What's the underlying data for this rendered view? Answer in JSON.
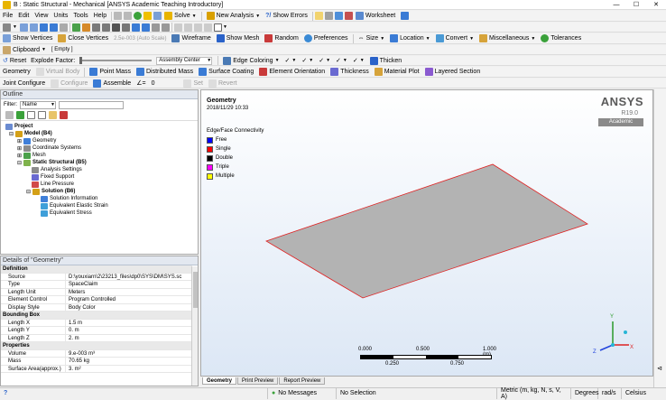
{
  "titlebar": {
    "title": "B : Static Structural - Mechanical [ANSYS Academic Teaching Introductory]"
  },
  "menu": [
    "File",
    "Edit",
    "View",
    "Units",
    "Tools",
    "Help"
  ],
  "toolbar1": {
    "solve": "Solve",
    "new_analysis": "New Analysis",
    "show_errors": "Show Errors",
    "worksheet": "Worksheet"
  },
  "toolbar2": {
    "show_vertices": "Show Vertices",
    "close_vertices": "Close Vertices",
    "close_vertices_value": "2.5e-003 (Auto Scale)",
    "wireframe": "Wireframe",
    "show_mesh": "Show Mesh",
    "random": "Random",
    "preferences": "Preferences",
    "size": "Size",
    "location": "Location",
    "convert": "Convert",
    "miscellaneous": "Miscellaneous",
    "tolerances": "Tolerances"
  },
  "toolbar3": {
    "clipboard": "Clipboard",
    "empty": "[ Empty ]"
  },
  "toolbar4": {
    "reset": "Reset",
    "explode_factor": "Explode Factor:",
    "assembly_center": "Assembly Center",
    "edge_coloring": "Edge Coloring",
    "thicken": "Thicken"
  },
  "toolbar5": {
    "geometry": "Geometry",
    "virtual_body": "Virtual Body",
    "point_mass": "Point Mass",
    "distributed_mass": "Distributed Mass",
    "surface_coating": "Surface Coating",
    "element_orientation": "Element Orientation",
    "thickness": "Thickness",
    "material_plot": "Material Plot",
    "layered_section": "Layered Section"
  },
  "toolbar6": {
    "joint_configure": "Joint Configure",
    "configure": "Configure",
    "assemble": "Assemble",
    "angle_value": "0",
    "set": "Set",
    "revert": "Revert"
  },
  "outline": {
    "title": "Outline",
    "filter_label": "Filter:",
    "filter_value": "Name",
    "tree": [
      {
        "label": "Project",
        "indent": 0,
        "bold": true,
        "color": "#6a8bd1"
      },
      {
        "label": "Model (B4)",
        "indent": 1,
        "bold": true,
        "color": "#d4a017"
      },
      {
        "label": "Geometry",
        "indent": 2,
        "bold": false,
        "color": "#3f7fd9"
      },
      {
        "label": "Coordinate Systems",
        "indent": 2,
        "bold": false,
        "color": "#8c8c8c"
      },
      {
        "label": "Mesh",
        "indent": 2,
        "bold": false,
        "color": "#4aa14a"
      },
      {
        "label": "Static Structural (B5)",
        "indent": 2,
        "bold": true,
        "color": "#7fb34c"
      },
      {
        "label": "Analysis Settings",
        "indent": 3,
        "bold": false,
        "color": "#8c8c8c"
      },
      {
        "label": "Fixed Support",
        "indent": 3,
        "bold": false,
        "color": "#6a6ad1"
      },
      {
        "label": "Line Pressure",
        "indent": 3,
        "bold": false,
        "color": "#d14a4a"
      },
      {
        "label": "Solution (B6)",
        "indent": 3,
        "bold": true,
        "color": "#d4a017"
      },
      {
        "label": "Solution Information",
        "indent": 4,
        "bold": false,
        "color": "#3f7fd9"
      },
      {
        "label": "Equivalent Elastic Strain",
        "indent": 4,
        "bold": false,
        "color": "#3f9fd9"
      },
      {
        "label": "Equivalent Stress",
        "indent": 4,
        "bold": false,
        "color": "#3f9fd9"
      }
    ]
  },
  "details": {
    "title": "Details of \"Geometry\"",
    "rows": [
      {
        "type": "group",
        "key": "Definition"
      },
      {
        "key": "Source",
        "value": "D:\\youxiarn\\2\\23213_files\\dp0\\SYS\\DM\\SYS.sc"
      },
      {
        "key": "Type",
        "value": "SpaceClaim"
      },
      {
        "key": "Length Unit",
        "value": "Meters"
      },
      {
        "key": "Element Control",
        "value": "Program Controlled"
      },
      {
        "key": "Display Style",
        "value": "Body Color"
      },
      {
        "type": "group",
        "key": "Bounding Box"
      },
      {
        "key": "Length X",
        "value": "1.5 m"
      },
      {
        "key": "Length Y",
        "value": "0. m"
      },
      {
        "key": "Length Z",
        "value": "2. m"
      },
      {
        "type": "group",
        "key": "Properties"
      },
      {
        "key": "Volume",
        "value": "9.e-003 m³"
      },
      {
        "key": "Mass",
        "value": "70.65 kg"
      },
      {
        "key": "Surface Area(approx.)",
        "value": "3. m²"
      }
    ]
  },
  "viewport": {
    "heading": "Geometry",
    "timestamp": "2018/11/29 10:33",
    "brand": "ANSYS",
    "version": "R19.0",
    "edition": "Academic",
    "legend_title": "Edge/Face Connectivity",
    "legend": [
      {
        "label": "Free",
        "color": "#0000ff"
      },
      {
        "label": "Single",
        "color": "#ff0000"
      },
      {
        "label": "Double",
        "color": "#000000"
      },
      {
        "label": "Triple",
        "color": "#ff00ff"
      },
      {
        "label": "Multiple",
        "color": "#ffff00"
      }
    ],
    "scale": {
      "t0": "0.000",
      "t1": "0.500",
      "t2": "1.000 (m)",
      "b1": "0.250",
      "b2": "0.750"
    },
    "axes": {
      "x": "X",
      "y": "Y",
      "z": "Z"
    },
    "tabs": [
      "Geometry",
      "Print Preview",
      "Report Preview"
    ]
  },
  "status": {
    "messages": "No Messages",
    "selection": "No Selection",
    "units": "Metric (m, kg, N, s, V, A)",
    "angle": "Degrees",
    "rate": "rad/s",
    "temp": "Celsius"
  }
}
